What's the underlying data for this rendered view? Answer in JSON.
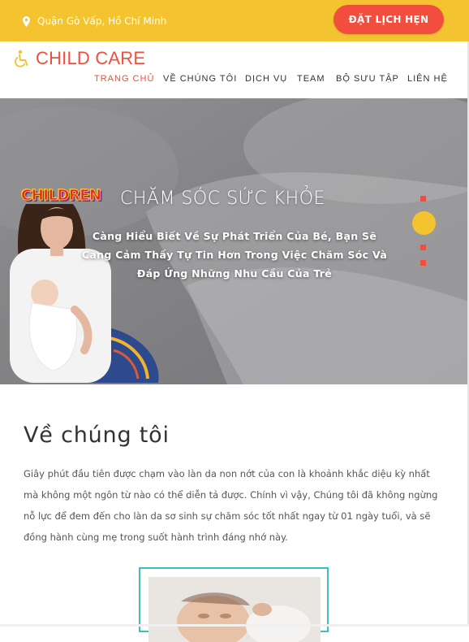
{
  "topbar": {
    "location": "Quận Gò Vấp, Hồ Chí Minh",
    "location_icon": "map-pin-icon",
    "cta_label": "ĐẶT LỊCH HẸN"
  },
  "header": {
    "logo_icon": "accessibility-icon",
    "logo_text": "CHILD CARE",
    "nav": [
      {
        "label": "TRANG CHỦ",
        "active": true
      },
      {
        "label": "VỀ CHÚNG TÔI",
        "active": false
      },
      {
        "label": "DỊCH VỤ",
        "active": false
      },
      {
        "label": "TEAM",
        "active": false
      },
      {
        "label": "BỘ SƯU TẬP",
        "active": false
      },
      {
        "label": "LIÊN HỆ",
        "active": false
      }
    ]
  },
  "hero": {
    "badge": "CHILDREN",
    "title": "CHĂM SÓC SỨC KHỎE",
    "subtitle": "Càng Hiểu Biết Về Sự Phát Triển Của Bé, Bạn Sẽ Càng Cảm Thấy Tự Tin Hơn Trong Việc Chăm Sóc Và Đáp Ứng Những Nhu Cầu Của Trẻ",
    "slides_count": 4,
    "active_slide_index": 1
  },
  "about": {
    "title": "Về chúng tôi",
    "text": "Giây phút đầu tiên được chạm vào làn da non nớt của con là khoảnh khắc diệu kỳ nhất mà không một ngôn từ nào có thể diễn tả được. Chính vì vậy, Chúng tôi đã không ngừng nỗ lực để đem đến cho làn da sơ sinh sự chăm sóc tốt nhất ngay từ 01 ngày tuổi, và sẽ đồng hành cùng mẹ trong suốt hành trình đáng nhớ này."
  },
  "colors": {
    "accent_yellow": "#f4c430",
    "accent_red": "#f24e3e",
    "frame_teal": "#3cc2b5"
  }
}
